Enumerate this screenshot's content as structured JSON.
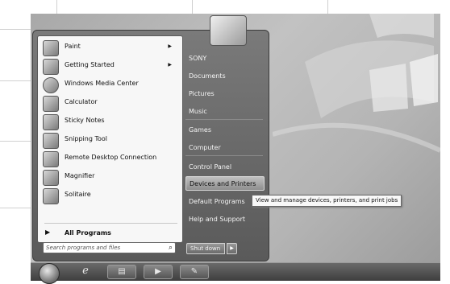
{
  "programs": [
    {
      "label": "Paint",
      "icon": "paint-icon",
      "has_submenu": true
    },
    {
      "label": "Getting Started",
      "icon": "getting-started-icon",
      "has_submenu": true
    },
    {
      "label": "Windows Media Center",
      "icon": "media-center-icon",
      "has_submenu": false
    },
    {
      "label": "Calculator",
      "icon": "calculator-icon",
      "has_submenu": false
    },
    {
      "label": "Sticky Notes",
      "icon": "sticky-notes-icon",
      "has_submenu": false
    },
    {
      "label": "Snipping Tool",
      "icon": "snipping-tool-icon",
      "has_submenu": false
    },
    {
      "label": "Remote Desktop Connection",
      "icon": "remote-desktop-icon",
      "has_submenu": false
    },
    {
      "label": "Magnifier",
      "icon": "magnifier-icon",
      "has_submenu": false
    },
    {
      "label": "Solitaire",
      "icon": "solitaire-icon",
      "has_submenu": false
    }
  ],
  "all_programs": {
    "label": "All Programs"
  },
  "search": {
    "placeholder": "Search programs and files"
  },
  "places": [
    {
      "label": "SONY"
    },
    {
      "label": "Documents"
    },
    {
      "label": "Pictures"
    },
    {
      "label": "Music"
    },
    {
      "label": "Games"
    },
    {
      "label": "Computer"
    },
    {
      "label": "Control Panel"
    },
    {
      "label": "Devices and Printers",
      "highlighted": true
    },
    {
      "label": "Default Programs"
    },
    {
      "label": "Help and Support"
    }
  ],
  "shutdown": {
    "label": "Shut down"
  },
  "tooltip": {
    "text": "View and manage devices, printers, and print jobs"
  },
  "taskbar": {
    "items": [
      "internet-explorer-icon",
      "windows-explorer-icon",
      "media-player-icon",
      "paint-icon"
    ]
  }
}
